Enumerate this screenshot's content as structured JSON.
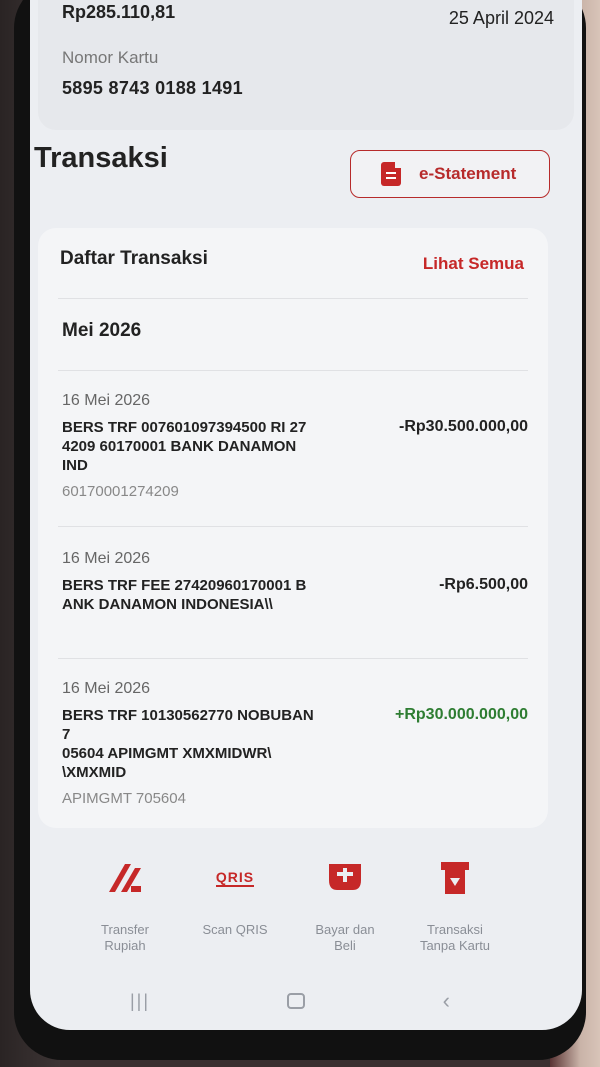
{
  "account": {
    "balance": "Rp285.110,81",
    "date": "25 April 2024",
    "card_label": "Nomor Kartu",
    "card_number": "5895 8743 0188 1491"
  },
  "section_title": "Transaksi",
  "estatement_label": "e-Statement",
  "transactions_card": {
    "header": "Daftar Transaksi",
    "see_all": "Lihat Semua",
    "month": "Mei 2026",
    "items": [
      {
        "date": "16 Mei 2026",
        "description": "BERS TRF 007601097394500 RI 27\n4209 60170001 BANK DANAMON\nIND",
        "amount": "-Rp30.500.000,00",
        "reference": "60170001274209"
      },
      {
        "date": "16 Mei 2026",
        "description": "BERS TRF FEE  27420960170001 B\nANK DANAMON INDONESIA\\\\",
        "amount": "-Rp6.500,00",
        "reference": ""
      },
      {
        "date": "16 Mei 2026",
        "description": "BERS TRF 10130562770 NOBUBAN\n7\n05604 APIMGMT XMXMIDWR\\\n\\XMXMID",
        "amount": "+Rp30.000.000,00",
        "reference": "APIMGMT 705604"
      }
    ]
  },
  "quick_menu": [
    {
      "label": "Transfer\nRupiah",
      "icon": "transfer-icon"
    },
    {
      "label": "Scan QRIS",
      "icon": "qris-icon",
      "icon_text": "QRIS"
    },
    {
      "label": "Bayar dan\nBeli",
      "icon": "bill-icon"
    },
    {
      "label": "Transaksi\nTanpa Kartu",
      "icon": "cardless-icon"
    }
  ],
  "colors": {
    "accent": "#c62828",
    "positive": "#2e7d32"
  }
}
